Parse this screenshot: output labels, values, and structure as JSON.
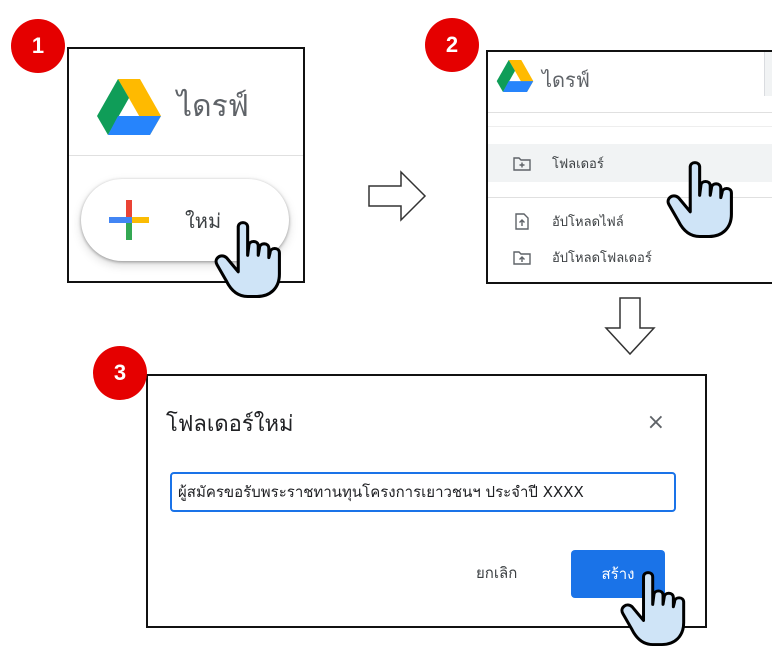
{
  "steps": [
    "1",
    "2",
    "3"
  ],
  "panel1": {
    "brand": "ไดรฟ์",
    "new_button_label": "ใหม่"
  },
  "panel2": {
    "brand": "ไดรฟ์",
    "menu": [
      {
        "label": "โฟลเดอร์",
        "icon": "new-folder-icon"
      },
      {
        "label": "อัปโหลดไฟล์",
        "icon": "file-upload-icon"
      },
      {
        "label": "อัปโหลดโฟลเดอร์",
        "icon": "folder-upload-icon"
      }
    ]
  },
  "dialog": {
    "title": "โฟลเดอร์ใหม่",
    "close_glyph": "×",
    "folder_name_value": "ผู้สมัครขอรับพระราชทานทุนโครงการเยาวชนฯ ประจำปี XXXX",
    "cancel_label": "ยกเลิก",
    "create_label": "สร้าง"
  },
  "colors": {
    "badge": "#e50000",
    "primary": "#1a73e8",
    "hand_fill": "#cfe4f7"
  }
}
